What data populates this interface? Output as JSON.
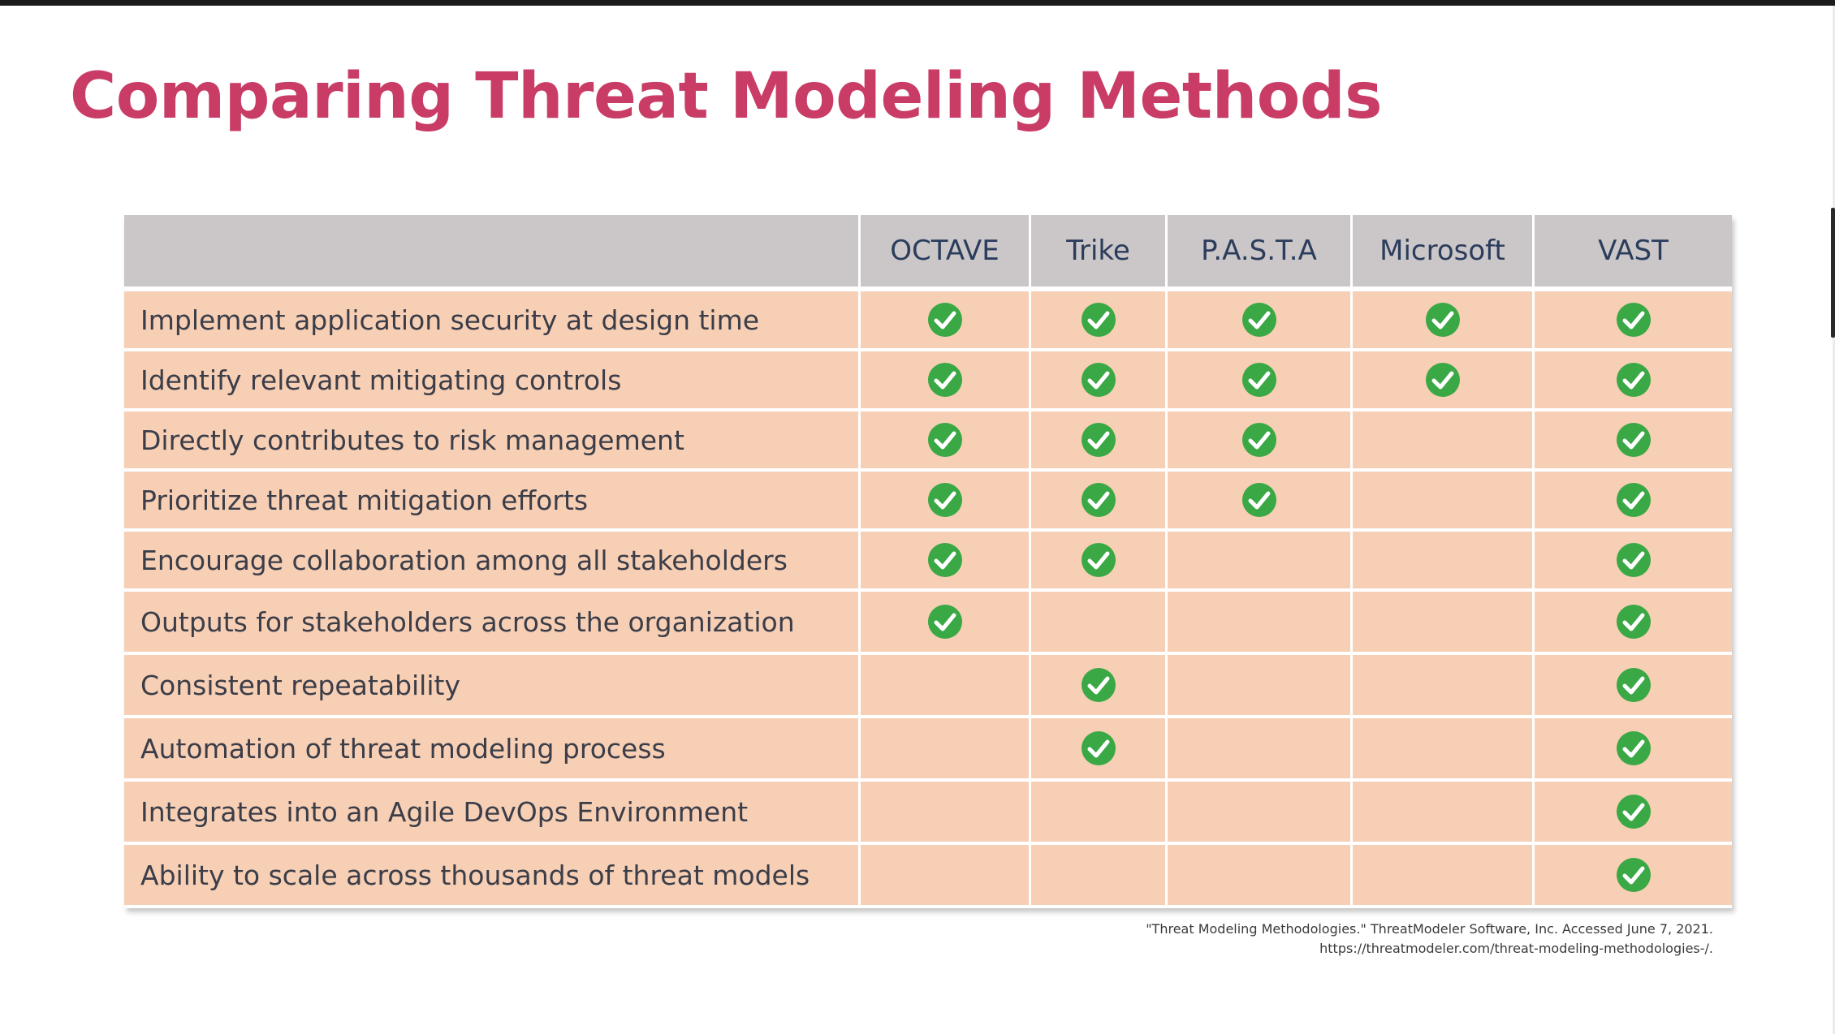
{
  "slide": {
    "title": "Comparing Threat Modeling Methods",
    "accent_color": "#c93c66",
    "header_color": "#cbc6c8",
    "row_color": "#f7cfb5",
    "check_color": "#3aa845"
  },
  "table": {
    "corner_label": "",
    "columns": [
      "OCTAVE",
      "Trike",
      "P.A.S.T.A",
      "Microsoft",
      "VAST"
    ],
    "rows": [
      {
        "feature": "Implement application security at design time",
        "marks": [
          true,
          true,
          true,
          true,
          true
        ]
      },
      {
        "feature": "Identify relevant mitigating controls",
        "marks": [
          true,
          true,
          true,
          true,
          true
        ]
      },
      {
        "feature": "Directly contributes to risk management",
        "marks": [
          true,
          true,
          true,
          false,
          true
        ]
      },
      {
        "feature": "Prioritize threat mitigation efforts",
        "marks": [
          true,
          true,
          true,
          false,
          true
        ]
      },
      {
        "feature": "Encourage collaboration among all stakeholders",
        "marks": [
          true,
          true,
          false,
          false,
          true
        ]
      },
      {
        "feature": "Outputs for stakeholders across the organization",
        "marks": [
          true,
          false,
          false,
          false,
          true
        ]
      },
      {
        "feature": "Consistent repeatability",
        "marks": [
          false,
          true,
          false,
          false,
          true
        ]
      },
      {
        "feature": "Automation of threat modeling process",
        "marks": [
          false,
          true,
          false,
          false,
          true
        ]
      },
      {
        "feature": "Integrates into an Agile DevOps Environment",
        "marks": [
          false,
          false,
          false,
          false,
          true
        ]
      },
      {
        "feature": "Ability to scale across thousands of threat models",
        "marks": [
          false,
          false,
          false,
          false,
          true
        ]
      }
    ],
    "check_icon": "check-circle-icon"
  },
  "caption": {
    "line1": "\"Threat Modeling Methodologies.\" ThreatModeler Software, Inc. Accessed June 7, 2021.",
    "line2": "https://threatmodeler.com/threat-modeling-methodologies-/."
  }
}
